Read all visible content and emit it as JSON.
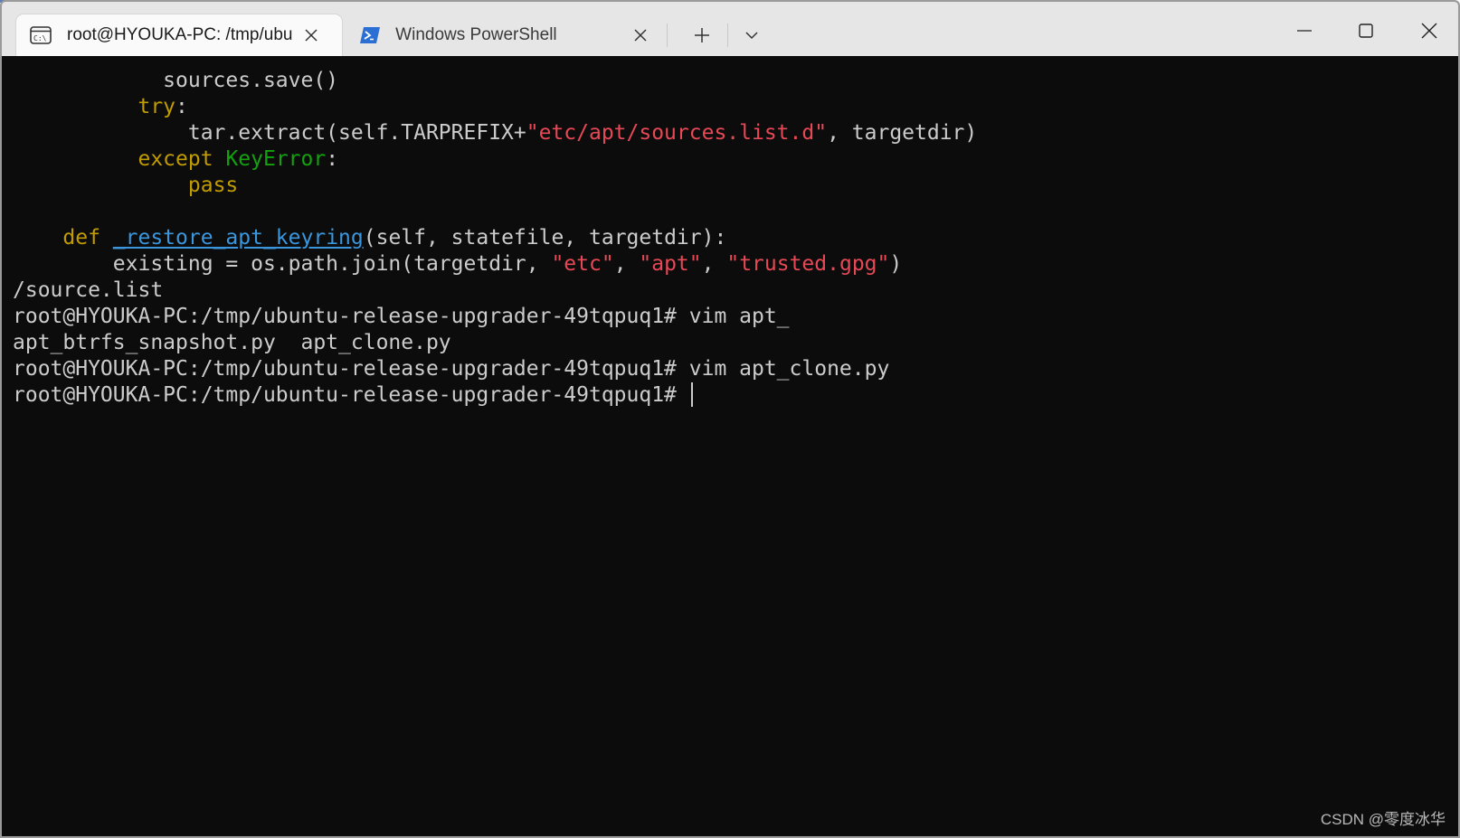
{
  "tabs": [
    {
      "title": "root@HYOUKA-PC: /tmp/ubu",
      "icon": "terminal-tab-icon",
      "active": true
    },
    {
      "title": "Windows PowerShell",
      "icon": "powershell-icon",
      "active": false
    }
  ],
  "terminal": {
    "lines": [
      [
        {
          "t": "            sources.save()"
        }
      ],
      [
        {
          "t": "          "
        },
        {
          "t": "try",
          "c": "kw"
        },
        {
          "t": ":"
        }
      ],
      [
        {
          "t": "              tar.extract(self.TARPREFIX+"
        },
        {
          "t": "\"etc/apt/sources.list.d\"",
          "c": "str"
        },
        {
          "t": ", targetdir)"
        }
      ],
      [
        {
          "t": "          "
        },
        {
          "t": "except",
          "c": "kw"
        },
        {
          "t": " "
        },
        {
          "t": "KeyError",
          "c": "cls"
        },
        {
          "t": ":"
        }
      ],
      [
        {
          "t": "              "
        },
        {
          "t": "pass",
          "c": "kw"
        }
      ],
      [
        {
          "t": ""
        }
      ],
      [
        {
          "t": "    "
        },
        {
          "t": "def",
          "c": "kw"
        },
        {
          "t": " "
        },
        {
          "t": "_restore_apt_keyring",
          "c": "fn"
        },
        {
          "t": "(self, statefile, targetdir):"
        }
      ],
      [
        {
          "t": "        existing = os.path.join(targetdir, "
        },
        {
          "t": "\"etc\"",
          "c": "str"
        },
        {
          "t": ", "
        },
        {
          "t": "\"apt\"",
          "c": "str"
        },
        {
          "t": ", "
        },
        {
          "t": "\"trusted.gpg\"",
          "c": "str"
        },
        {
          "t": ")"
        }
      ],
      [
        {
          "t": "/source.list"
        }
      ],
      [
        {
          "t": "root@HYOUKA-PC:/tmp/ubuntu-release-upgrader-49tqpuq1# vim apt_"
        }
      ],
      [
        {
          "t": "apt_btrfs_snapshot.py  apt_clone.py"
        }
      ],
      [
        {
          "t": "root@HYOUKA-PC:/tmp/ubuntu-release-upgrader-49tqpuq1# vim apt_clone.py"
        }
      ],
      [
        {
          "t": "root@HYOUKA-PC:/tmp/ubuntu-release-upgrader-49tqpuq1# "
        }
      ]
    ]
  },
  "watermark": "CSDN @零度冰华",
  "colors": {
    "background": "#0c0c0c",
    "foreground": "#cccccc",
    "keyword": "#c19c00",
    "class": "#13a10e",
    "function": "#3a96dd",
    "string": "#e74856",
    "titlebar": "#e6e6e6"
  }
}
